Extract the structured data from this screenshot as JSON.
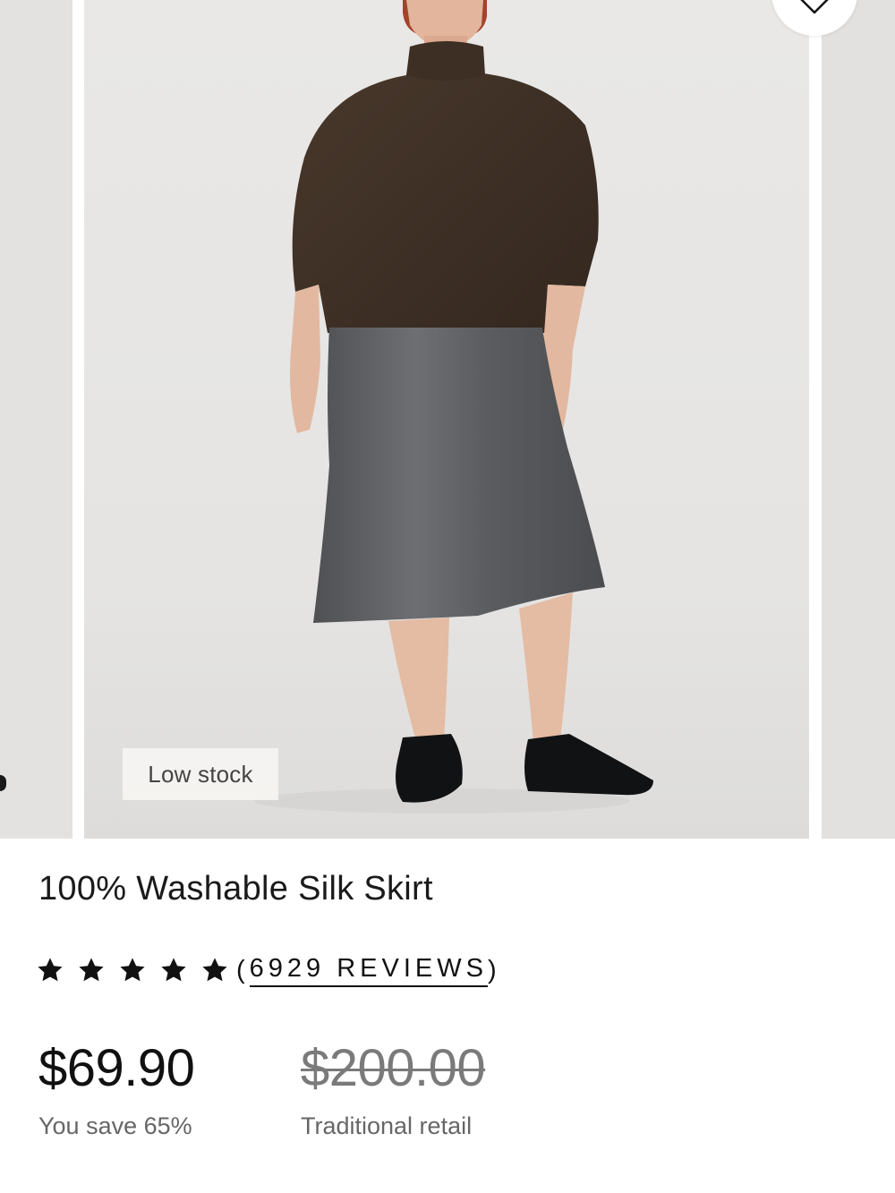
{
  "product": {
    "badge": "Low stock",
    "title": "100% Washable Silk Skirt",
    "rating": {
      "stars": 5,
      "open_paren": "(",
      "reviews_count": "6929 REVIEWS",
      "close_paren": ")"
    },
    "price": {
      "sale": "$69.90",
      "savings": "You save 65%",
      "retail": "$200.00",
      "retail_label": "Traditional retail"
    }
  },
  "icons": {
    "wishlist": "heart-icon",
    "rating": "star-icon"
  },
  "colors": {
    "text": "#111111",
    "muted": "#666666",
    "strike": "#7a7a7a",
    "photo_bg": "#e6e5e3",
    "sweater": "#3f3026",
    "skirt": "#5f6165"
  }
}
